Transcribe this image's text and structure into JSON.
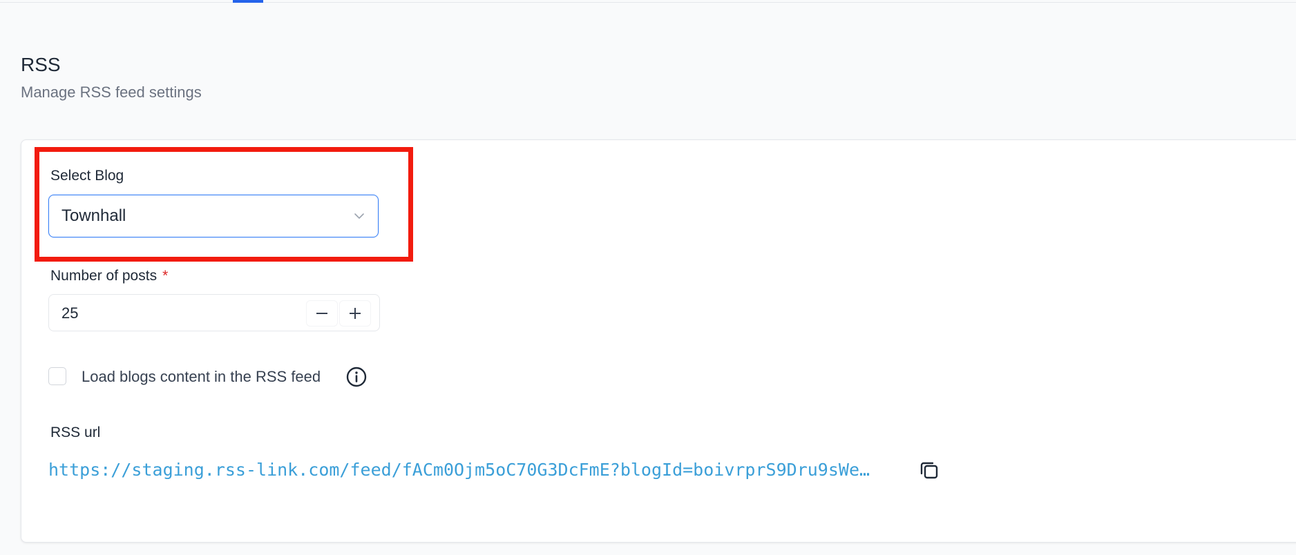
{
  "page": {
    "title": "RSS",
    "subtitle": "Manage RSS feed settings"
  },
  "select_blog": {
    "label": "Select Blog",
    "value": "Townhall"
  },
  "number_of_posts": {
    "label": "Number of posts",
    "required_mark": "*",
    "value": "25"
  },
  "load_content": {
    "label": "Load blogs content in the RSS feed",
    "checked": false
  },
  "rss_url": {
    "label": "RSS url",
    "value": "https://staging.rss-link.com/feed/fACm0Ojm5oC70G3DcFmE?blogId=boivrprS9Dru9sWe…"
  },
  "icons": {
    "select": "chevron-down-icon",
    "decrement": "minus-icon",
    "increment": "plus-icon",
    "info": "info-icon",
    "copy": "copy-icon"
  },
  "colors": {
    "accent": "#2563eb",
    "highlight": "#f21b0e",
    "link": "#3b9fd8",
    "required": "#dc2626"
  }
}
